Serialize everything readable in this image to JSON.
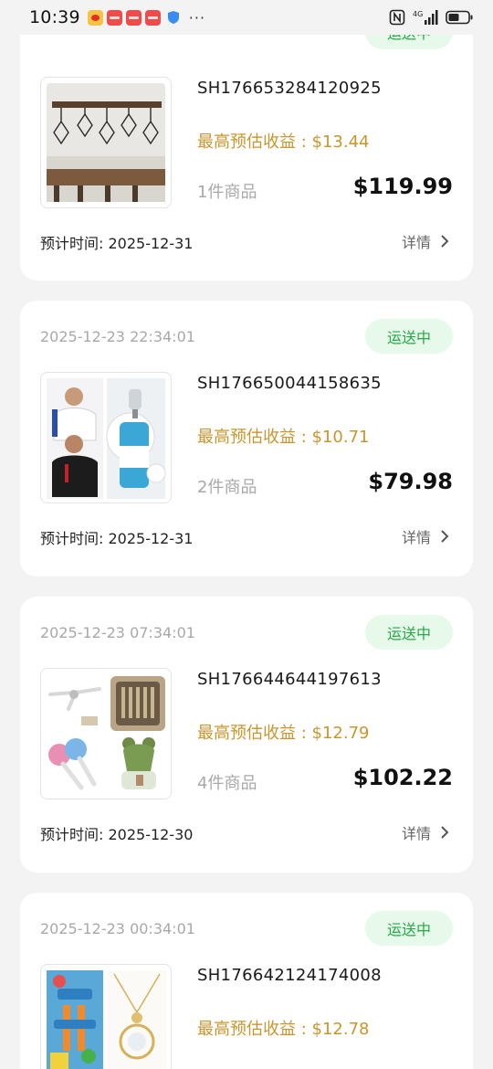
{
  "status_bar": {
    "time": "10:39",
    "dots": "···"
  },
  "colors": {
    "earn": "#c9962e",
    "badge_text": "#26a845",
    "badge_bg": "#e7f9ea"
  },
  "icons": [
    "weibo-icon",
    "app-red-icon",
    "shield-icon",
    "nfc-icon",
    "signal-icon",
    "battery-icon",
    "chevron-right-icon"
  ],
  "orders": [
    {
      "date": "",
      "status": "运送中",
      "order_no": "SH176653284120925",
      "earnings": "最高预估收益 : $13.44",
      "item_count": "1件商品",
      "price": "$119.99",
      "eta": "预计时间: 2025-12-31",
      "detail": "详情"
    },
    {
      "date": "2025-12-23 22:34:01",
      "status": "运送中",
      "order_no": "SH176650044158635",
      "earnings": "最高预估收益 : $10.71",
      "item_count": "2件商品",
      "price": "$79.98",
      "eta": "预计时间: 2025-12-31",
      "detail": "详情"
    },
    {
      "date": "2025-12-23 07:34:01",
      "status": "运送中",
      "order_no": "SH176644644197613",
      "earnings": "最高预估收益 : $12.79",
      "item_count": "4件商品",
      "price": "$102.22",
      "eta": "预计时间: 2025-12-30",
      "detail": "详情"
    },
    {
      "date": "2025-12-23 00:34:01",
      "status": "运送中",
      "order_no": "SH176642124174008",
      "earnings": "最高预估收益 : $12.78",
      "item_count": "",
      "price": "",
      "eta": "",
      "detail": ""
    }
  ]
}
